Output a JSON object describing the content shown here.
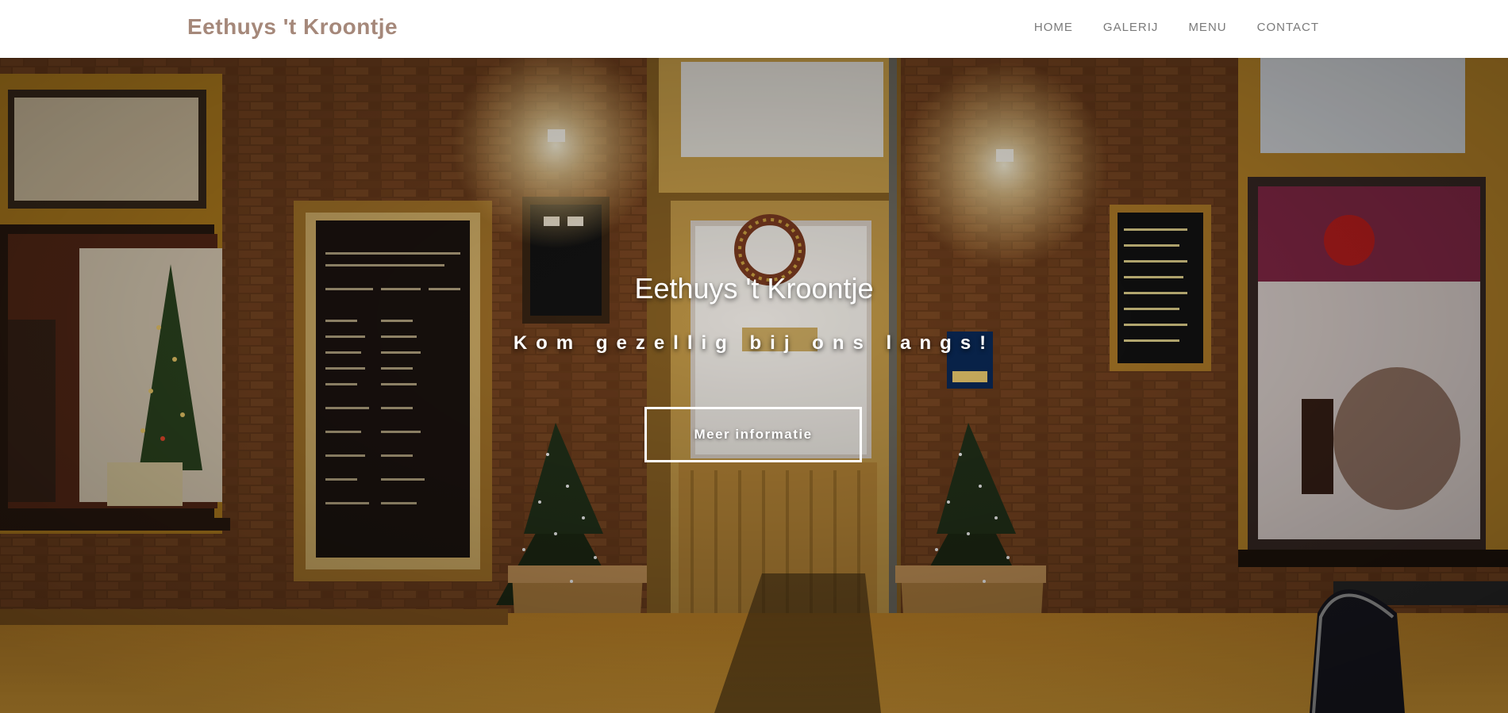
{
  "brand": {
    "name": "Eethuys 't Kroontje",
    "color": "#a5887a"
  },
  "nav": {
    "items": [
      {
        "label": "HOME"
      },
      {
        "label": "GALERIJ"
      },
      {
        "label": "MENU"
      },
      {
        "label": "CONTACT"
      }
    ]
  },
  "hero": {
    "title": "Eethuys 't Kroontje",
    "subtitle": "Kom gezellig bij ons langs!",
    "button_label": "Meer informatie",
    "background_image": "restaurant-storefront-night-photo"
  }
}
